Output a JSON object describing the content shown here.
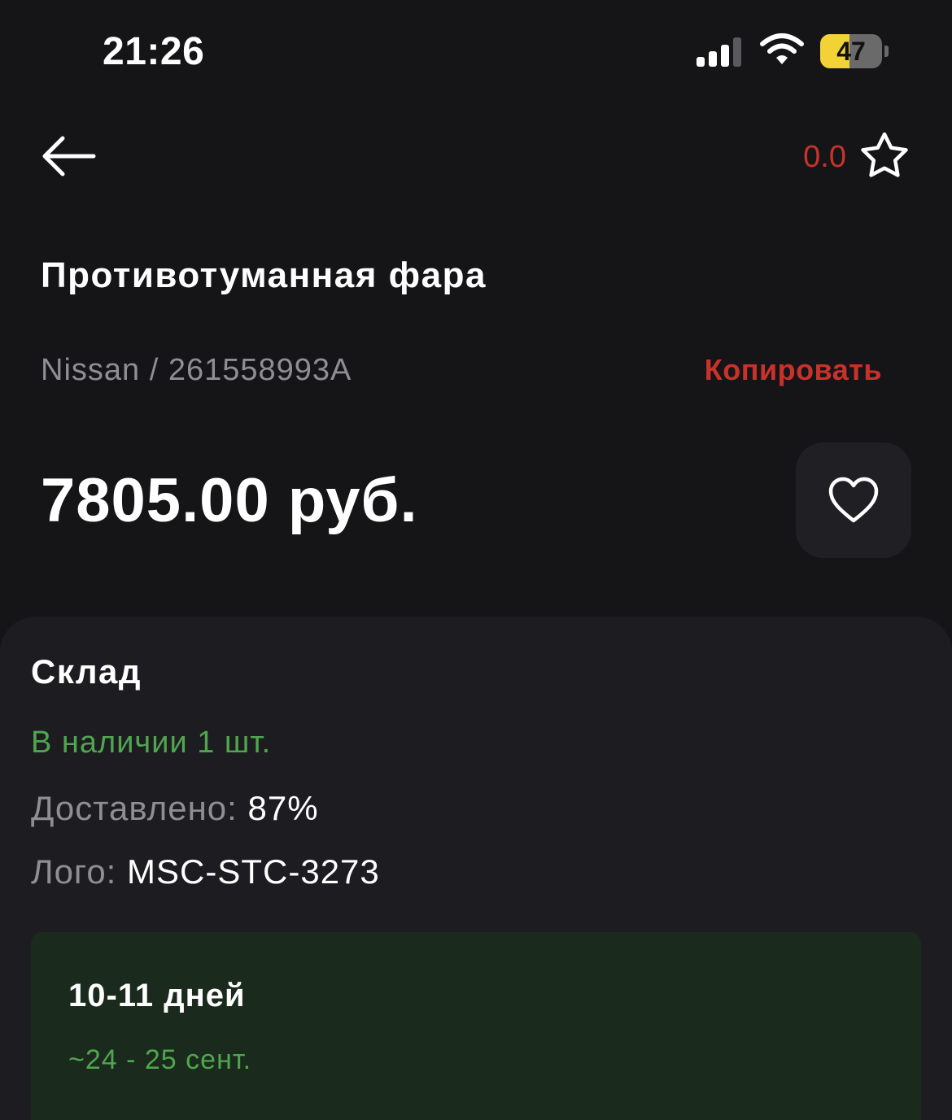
{
  "status_bar": {
    "time": "21:26",
    "battery_level": "47",
    "battery_fraction": 0.47,
    "signal_icon": "cellular-signal-icon",
    "wifi_icon": "wifi-icon"
  },
  "header": {
    "back_icon": "arrow-left-icon",
    "rating_value": "0.0",
    "rating_icon": "star-outline-icon"
  },
  "product": {
    "title": "Противотуманная фара",
    "brand_article": "Nissan / 261558993A",
    "copy_label": "Копировать",
    "price": "7805.00 руб.",
    "favorite_icon": "heart-outline-icon"
  },
  "warehouse": {
    "title": "Склад",
    "stock_status": "В наличии 1 шт.",
    "delivered_label": "Доставлено:",
    "delivered_value": "87%",
    "logo_label": "Лого:",
    "logo_value": "MSC-STC-3273",
    "delivery_days": "10-11 дней",
    "delivery_dates": "~24 - 25 сент."
  },
  "colors": {
    "background": "#151518",
    "accent_red": "#c8322a",
    "accent_green": "#4fa64e",
    "card_background": "#1d1d21",
    "delivery_background": "#1a2a1d"
  }
}
